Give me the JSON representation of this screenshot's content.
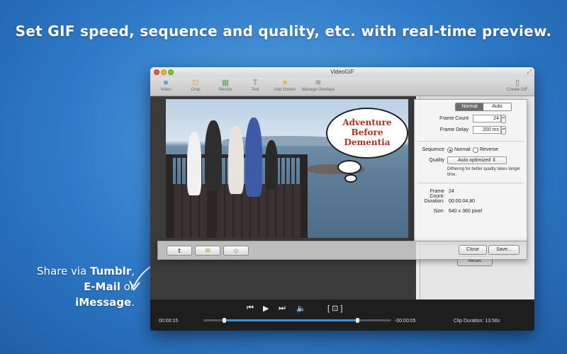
{
  "headline": "Set GIF speed, sequence and quality, etc. with real-time preview.",
  "share_note": {
    "line1_prefix": "Share via ",
    "line1_bold": "Tumblr",
    "line1_suffix": ",",
    "line2_bold": "E-Mail",
    "line2_suffix": " or",
    "line3_bold": "iMessage",
    "line3_suffix": "."
  },
  "window": {
    "title": "VideoGIF"
  },
  "toolbar": {
    "video": "Video",
    "crop": "Crop",
    "resize": "Resize",
    "text": "Text",
    "add_sticker": "Add Sticker",
    "manage_overlays": "Manage Overlays",
    "create_gif": "Create GIF"
  },
  "photo": {
    "bubble_line1": "Adventure",
    "bubble_line2": "Before",
    "bubble_line3": "Dementia"
  },
  "settings": {
    "mode_normal": "Normal",
    "mode_auto": "Auto",
    "frame_count_label": "Frame Count",
    "frame_count_value": "24",
    "frame_delay_label": "Frame Delay",
    "frame_delay_value": "200 ms",
    "sequence_label": "Sequence",
    "seq_normal": "Normal",
    "seq_reverse": "Reverse",
    "quality_label": "Quality",
    "quality_value": "Auto optimized",
    "quality_hint": "Dithering for better quality takes longer time.",
    "info_frame_count_label": "Frame Count:",
    "info_frame_count_value": "24",
    "info_duration_label": "Duration:",
    "info_duration_value": "00:00:04.80",
    "info_size_label": "Size:",
    "info_size_value": "640 x 360 pixel"
  },
  "share": {
    "tumblr": "t",
    "mail": "✉",
    "imessage": "☺"
  },
  "buttons": {
    "close": "Close",
    "save": "Save...",
    "reset": "Reset"
  },
  "player": {
    "time_start": "00:00:15",
    "time_end": "-00:00:05",
    "clip_duration": "Clip Duration: 13.56s",
    "selection_start": 0.11,
    "selection_end": 0.82
  },
  "colors": {
    "accent": "#3d8fe6",
    "bubble_text": "#b5311f"
  }
}
